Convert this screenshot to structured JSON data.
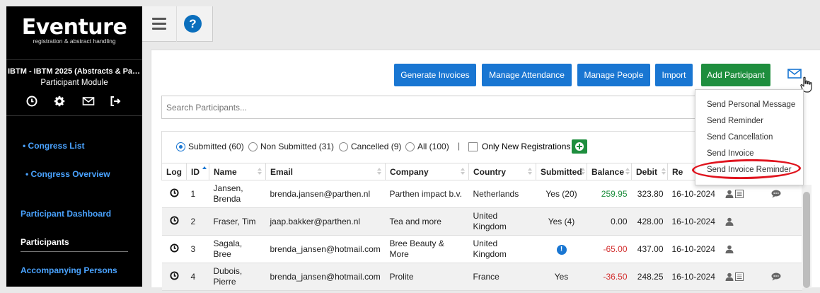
{
  "sidebar": {
    "logo_name": "Eventure",
    "logo_tagline": "registration & abstract handling",
    "event_title": "IBTM - IBTM 2025 (Abstracts & Par...",
    "module_name": "Participant Module",
    "nav": {
      "congress_list": "• Congress List",
      "congress_overview": "• Congress Overview",
      "participant_dashboard": "Participant Dashboard",
      "participants": "Participants",
      "accompanying_persons": "Accompanying Persons"
    }
  },
  "toolbar": {
    "generate_invoices": "Generate Invoices",
    "manage_attendance": "Manage Attendance",
    "manage_people": "Manage People",
    "import": "Import",
    "add_participant": "Add Participant"
  },
  "search": {
    "placeholder": "Search Participants..."
  },
  "filters": {
    "submitted": "Submitted (60)",
    "non_submitted": "Non Submitted (31)",
    "cancelled": "Cancelled (9)",
    "all": "All (100)",
    "separator": "|",
    "only_new": "Only New Registrations"
  },
  "table": {
    "headers": [
      "Log",
      "ID",
      "Name",
      "Email",
      "Company",
      "Country",
      "Submitted",
      "Balance",
      "Debit",
      "Re"
    ],
    "rows": [
      {
        "id": "1",
        "name": "Jansen, Brenda",
        "email": "brenda.jansen@parthen.nl",
        "company": "Parthen impact b.v.",
        "country": "Netherlands",
        "submitted": "Yes (20)",
        "balance": "259.95",
        "debit": "323.80",
        "date": "16-10-2024"
      },
      {
        "id": "2",
        "name": "Fraser, Tim",
        "email": "jaap.bakker@parthen.nl",
        "company": "Tea and more",
        "country": "United Kingdom",
        "submitted": "Yes (4)",
        "balance": "0.00",
        "debit": "428.00",
        "date": "16-10-2024"
      },
      {
        "id": "3",
        "name": "Sagala, Bree",
        "email": "brenda_jansen@hotmail.com",
        "company": "Bree Beauty & More",
        "country": "United Kingdom",
        "submitted": "",
        "balance": "-65.00",
        "debit": "437.00",
        "date": "16-10-2024"
      },
      {
        "id": "4",
        "name": "Dubois, Pierre",
        "email": "brenda_jansen@hotmail.com",
        "company": "Prolite",
        "country": "France",
        "submitted": "Yes",
        "balance": "-36.50",
        "debit": "248.25",
        "date": "16-10-2024"
      }
    ]
  },
  "dropdown": {
    "items": [
      "Send Personal Message",
      "Send Reminder",
      "Send Cancellation",
      "Send Invoice",
      "Send Invoice Reminder"
    ]
  },
  "colors": {
    "primary": "#1976d2",
    "success": "#1e8e3e",
    "danger": "#d32f2f",
    "highlight": "#e0141e"
  }
}
